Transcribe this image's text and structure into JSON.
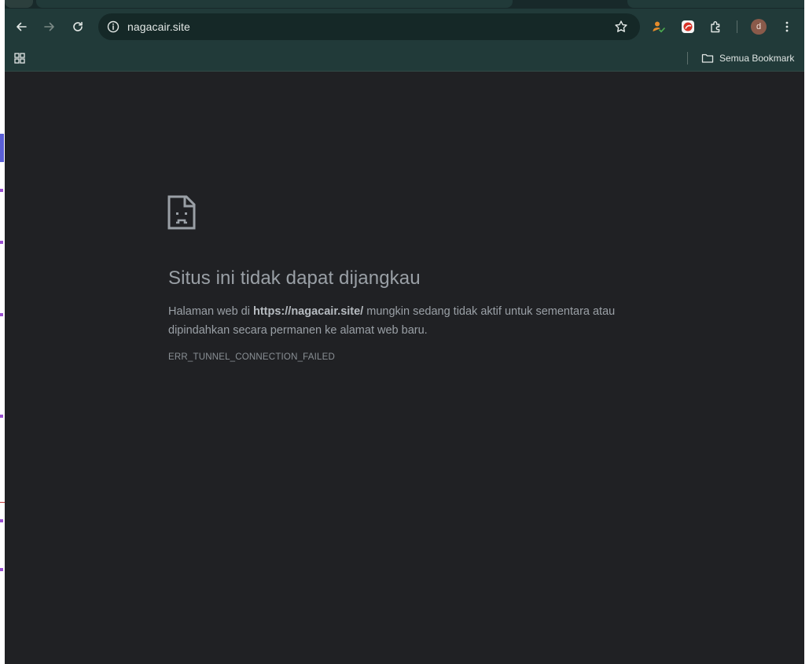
{
  "browser": {
    "address_bar": {
      "url": "nagacair.site"
    },
    "bookmarks_bar": {
      "all_bookmarks_label": "Semua Bookmark"
    },
    "profile": {
      "initial": "d"
    }
  },
  "error_page": {
    "title": "Situs ini tidak dapat dijangkau",
    "description_prefix": "Halaman web di ",
    "description_url": "https://nagacair.site/",
    "description_suffix": " mungkin sedang tidak aktif untuk sementara atau dipindahkan secara permanen ke alamat web baru.",
    "error_code": "ERR_TUNNEL_CONNECTION_FAILED"
  },
  "colors": {
    "frame": "#213a39",
    "page_background": "#202124",
    "text": "#9aa0a6"
  }
}
